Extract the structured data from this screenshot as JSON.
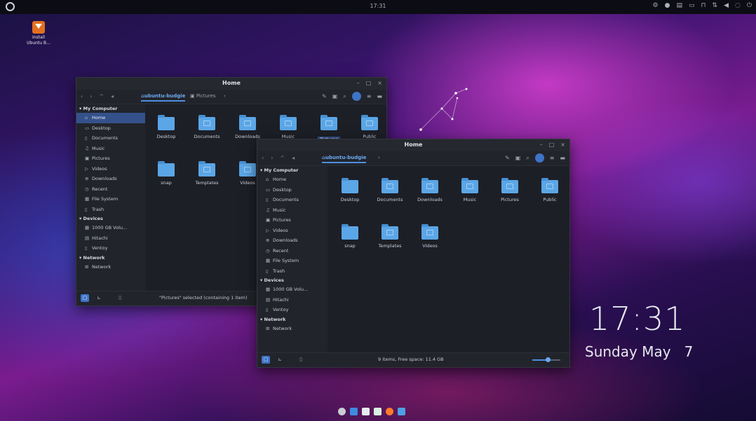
{
  "topbar": {
    "clock": "17:31"
  },
  "desktop_icon": {
    "label_line1": "Install",
    "label_line2": "Ubuntu B..."
  },
  "desktop_clock": {
    "time": "17:31",
    "date": "Sunday May   7"
  },
  "colors": {
    "accent": "#4d8fe0",
    "selection": "#35518a",
    "folder": "#5ba6e6",
    "window_bg": "#1d1f26"
  },
  "window_back": {
    "title": "Home",
    "breadcrumb_active": "ubuntu-budgie",
    "breadcrumb_next": "Pictures",
    "sidebar": [
      {
        "type": "head",
        "label": "My Computer"
      },
      {
        "label": "Home",
        "icon": "home-icon",
        "glyph": "⌂",
        "selected": true
      },
      {
        "label": "Desktop",
        "icon": "desktop-icon",
        "glyph": "▭"
      },
      {
        "label": "Documents",
        "icon": "document-icon",
        "glyph": "▯"
      },
      {
        "label": "Music",
        "icon": "music-icon",
        "glyph": "♫"
      },
      {
        "label": "Pictures",
        "icon": "picture-icon",
        "glyph": "▣"
      },
      {
        "label": "Videos",
        "icon": "video-icon",
        "glyph": "▷"
      },
      {
        "label": "Downloads",
        "icon": "download-icon",
        "glyph": "⊕"
      },
      {
        "label": "Recent",
        "icon": "recent-icon",
        "glyph": "◷"
      },
      {
        "label": "File System",
        "icon": "drive-icon",
        "glyph": "▦"
      },
      {
        "label": "Trash",
        "icon": "trash-icon",
        "glyph": "▯"
      },
      {
        "type": "head",
        "label": "Devices"
      },
      {
        "label": "1000 GB Volu...",
        "icon": "drive-icon",
        "glyph": "▦"
      },
      {
        "label": "Hitachi",
        "icon": "drive-icon",
        "glyph": "▤"
      },
      {
        "label": "Ventoy",
        "icon": "usb-icon",
        "glyph": "▯"
      },
      {
        "type": "head",
        "label": "Network"
      },
      {
        "label": "Network",
        "icon": "network-icon",
        "glyph": "⊞"
      }
    ],
    "files": [
      {
        "name": "Desktop",
        "plain": true
      },
      {
        "name": "Documents"
      },
      {
        "name": "Downloads"
      },
      {
        "name": "Music"
      },
      {
        "name": "Pictures",
        "selected": true
      },
      {
        "name": "Public"
      },
      {
        "name": "snap",
        "plain": true
      },
      {
        "name": "Templates"
      },
      {
        "name": "Videos"
      }
    ],
    "status": "\"Pictures\" selected (containing 1 item)"
  },
  "window_front": {
    "title": "Home",
    "breadcrumb_active": "ubuntu-budgie",
    "sidebar": [
      {
        "type": "head",
        "label": "My Computer"
      },
      {
        "label": "Home",
        "icon": "home-icon",
        "glyph": "⌂"
      },
      {
        "label": "Desktop",
        "icon": "desktop-icon",
        "glyph": "▭"
      },
      {
        "label": "Documents",
        "icon": "document-icon",
        "glyph": "▯"
      },
      {
        "label": "Music",
        "icon": "music-icon",
        "glyph": "♫"
      },
      {
        "label": "Pictures",
        "icon": "picture-icon",
        "glyph": "▣"
      },
      {
        "label": "Videos",
        "icon": "video-icon",
        "glyph": "▷"
      },
      {
        "label": "Downloads",
        "icon": "download-icon",
        "glyph": "⊕"
      },
      {
        "label": "Recent",
        "icon": "recent-icon",
        "glyph": "◷"
      },
      {
        "label": "File System",
        "icon": "drive-icon",
        "glyph": "▦"
      },
      {
        "label": "Trash",
        "icon": "trash-icon",
        "glyph": "▯"
      },
      {
        "type": "head",
        "label": "Devices"
      },
      {
        "label": "1000 GB Volu...",
        "icon": "drive-icon",
        "glyph": "▦"
      },
      {
        "label": "Hitachi",
        "icon": "drive-icon",
        "glyph": "▤"
      },
      {
        "label": "Ventoy",
        "icon": "usb-icon",
        "glyph": "▯"
      },
      {
        "type": "head",
        "label": "Network"
      },
      {
        "label": "Network",
        "icon": "network-icon",
        "glyph": "⊞"
      }
    ],
    "files": [
      {
        "name": "Desktop",
        "plain": true
      },
      {
        "name": "Documents"
      },
      {
        "name": "Downloads"
      },
      {
        "name": "Music"
      },
      {
        "name": "Pictures"
      },
      {
        "name": "Public"
      },
      {
        "name": "snap",
        "plain": true
      },
      {
        "name": "Templates"
      },
      {
        "name": "Videos"
      }
    ],
    "status": "9 items, Free space: 11.4 GB",
    "zoom_level": 0.55
  },
  "dock": [
    "budgie-menu-icon",
    "files-icon",
    "text-editor-icon",
    "document-icon",
    "firefox-icon",
    "folder-icon"
  ]
}
